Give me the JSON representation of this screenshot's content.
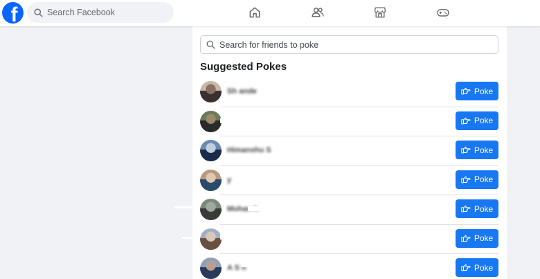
{
  "header": {
    "logo_letter": "f",
    "search_placeholder": "Search Facebook",
    "nav_icons": [
      "home-icon",
      "friends-icon",
      "marketplace-icon",
      "gaming-icon"
    ]
  },
  "pokes": {
    "search_placeholder": "Search for friends to poke",
    "section_title": "Suggested Pokes",
    "button_label": "Poke",
    "button_icon": "poke-hand-icon",
    "items": [
      {
        "name": "Sh       ande",
        "avatar": [
          "#c9b8a8",
          "#3a3030",
          "#8a7060"
        ]
      },
      {
        "name": "             ",
        "avatar": [
          "#6a7a5a",
          "#2a2a2a",
          "#9a8a6a"
        ]
      },
      {
        "name": "Himanshu S",
        "avatar": [
          "#6a8ab0",
          "#1a2a4a",
          "#c0d0e0"
        ]
      },
      {
        "name": "          y",
        "avatar": [
          "#b89a80",
          "#2a4a6a",
          "#e0c8b0"
        ]
      },
      {
        "name": "Mohan       h",
        "avatar": [
          "#7a8a7a",
          "#3a3a3a",
          "#a0a8a0"
        ]
      },
      {
        "name": "             ",
        "avatar": [
          "#a0b0c8",
          "#6a5040",
          "#d8c8b8"
        ]
      },
      {
        "name": "A     S  h",
        "avatar": [
          "#90a0b8",
          "#2a3a5a",
          "#b8a090"
        ]
      }
    ]
  },
  "colors": {
    "brand": "#0866ff",
    "button": "#1877f2",
    "page_bg": "#f0f2f5"
  }
}
